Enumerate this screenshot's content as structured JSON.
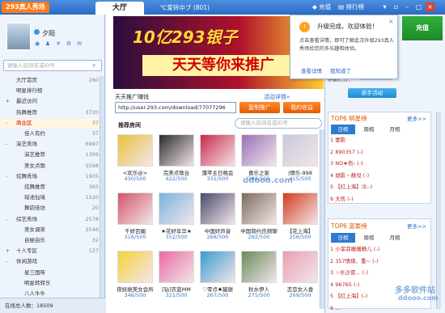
{
  "titlebar": {
    "logo": "293真人秀场",
    "tab_hall": "大厅",
    "tab_room": "℃爱转中ブ (801)",
    "recharge": "充值",
    "ranking": "排行榜"
  },
  "user": {
    "name": "夕阳"
  },
  "left": {
    "search_placeholder": "请输入房间名或ID号",
    "menu": [
      {
        "label": "大厅首页",
        "count": "260",
        "toggle": ""
      },
      {
        "label": "明星排行榜",
        "count": "",
        "toggle": ""
      },
      {
        "label": "最近访问",
        "count": "",
        "toggle": "+"
      },
      {
        "label": "热舞推荐",
        "count": "3720",
        "toggle": ""
      },
      {
        "label": "商业区",
        "count": "37",
        "toggle": "-"
      },
      {
        "label": "佳人有约",
        "count": "37",
        "toggle": "",
        "sub": true
      },
      {
        "label": "演艺秀场",
        "count": "6997",
        "toggle": "-"
      },
      {
        "label": "演艺推荐",
        "count": "1399",
        "toggle": "",
        "sub": true
      },
      {
        "label": "美女点歌",
        "count": "5598",
        "toggle": "",
        "sub": true
      },
      {
        "label": "炫舞秀场",
        "count": "1905",
        "toggle": "-"
      },
      {
        "label": "炫舞推荐",
        "count": "365",
        "toggle": "",
        "sub": true
      },
      {
        "label": "瑶池仙境",
        "count": "1520",
        "toggle": "",
        "sub": true
      },
      {
        "label": "舞韵佳坊",
        "count": "20",
        "toggle": "",
        "sub": true
      },
      {
        "label": "综艺秀场",
        "count": "2578",
        "toggle": "-"
      },
      {
        "label": "美女调笑",
        "count": "2546",
        "toggle": "",
        "sub": true
      },
      {
        "label": "自娱自乐",
        "count": "32",
        "toggle": "",
        "sub": true
      },
      {
        "label": "十人专区",
        "count": "127",
        "toggle": "+"
      },
      {
        "label": "休闲游戏",
        "count": "",
        "toggle": "-"
      },
      {
        "label": "星三国味",
        "count": "",
        "toggle": "",
        "sub": true
      },
      {
        "label": "明星转转乐",
        "count": "",
        "toggle": "",
        "sub": true
      },
      {
        "label": "八人牛牛",
        "count": "",
        "toggle": "",
        "sub": true
      }
    ],
    "status": "在线总人数：18509"
  },
  "banner": {
    "top_text": "10亿293银子",
    "bottom_text": "天天等你来推广"
  },
  "share": {
    "title": "天天推广赚钱",
    "help": "活动详情»",
    "url": "http://user.293.com/download/77077296",
    "copy_btn": "复制推广",
    "income_btn": "我的收益"
  },
  "rooms": {
    "title": "推荐房间",
    "search_placeholder": "请输入房间名或ID号",
    "items": [
      {
        "name": "<欢乐@>",
        "count": "430/500",
        "color": "#e8c13a"
      },
      {
        "name": "完美点歌台",
        "count": "422/500",
        "color": "#2a2a2a"
      },
      {
        "name": "蒲芊主日晚会",
        "count": "331/500",
        "color": "#c9284a"
      },
      {
        "name": "喜乐之家",
        "count": "398/500",
        "color": "#9a6fb8"
      },
      {
        "name": "|情乐-998",
        "count": "415/500",
        "color": "#c8c8d8"
      },
      {
        "name": "千娇百媚",
        "count": "316/500",
        "color": "#d4566a"
      },
      {
        "name": "★花好年华★",
        "count": "352/500",
        "color": "#7ab3e0"
      },
      {
        "name": "中国好声音",
        "count": "268/500",
        "color": "#4a4a6a"
      },
      {
        "name": "中国简约氏频聊",
        "count": "282/500",
        "color": "#7d6b5a"
      },
      {
        "name": "【花上海】",
        "count": "256/500",
        "color": "#d43c1c"
      },
      {
        "name": "夜妖娆美女会所",
        "count": "346/500",
        "color": "#f5d23a"
      },
      {
        "name": "[钻]衣蓝MM",
        "count": "321/500",
        "color": "#e86aa0"
      },
      {
        "name": "♡零点♠蹦谢",
        "count": "267/500",
        "color": "#3a9ad0"
      },
      {
        "name": "秋水伊人",
        "count": "275/500",
        "color": "#6a8a5a"
      },
      {
        "name": "恋恋女人香",
        "count": "269/500",
        "color": "#e8a0b0"
      }
    ]
  },
  "popup": {
    "title": "升级完成，欢迎体验！",
    "body": "点击查看详情，即可了解此次升级293真人秀场给您的多乐趣和体验。",
    "link_details": "查看详情",
    "link_ok": "我知道了",
    "close": "×"
  },
  "right": {
    "recharge": "充值",
    "level_label": "等级积分：",
    "newbie": "新手活动",
    "star_rank": {
      "title": "TOP6 明星榜",
      "more": "更多>>",
      "tabs": [
        "日榜",
        "周榜",
        "月榜"
      ],
      "rows": [
        "1 壹影",
        "2 890357 (-)",
        "3 NO★伤‹ (-)",
        "4 胡影丶静児 (-)",
        "5 【红上海】冷:-)",
        "6 大伤 (-)"
      ]
    },
    "rich_rank": {
      "title": "TOP6 富豪榜",
      "more": "更多>>",
      "tabs": [
        "日榜",
        "周榜",
        "月榜"
      ],
      "rows": [
        "1 小菲菲暖暖静儿 (-)",
        "2 357情缘、重~ (-)",
        "3 ☆长沙冒... (-)",
        "4 96765 (-)",
        "5 【红上海】(-)",
        "6 ..."
      ]
    }
  },
  "watermark": {
    "mid": "ddooo.com",
    "corner": "多多软件站",
    "corner_url": "ddooo.com"
  }
}
